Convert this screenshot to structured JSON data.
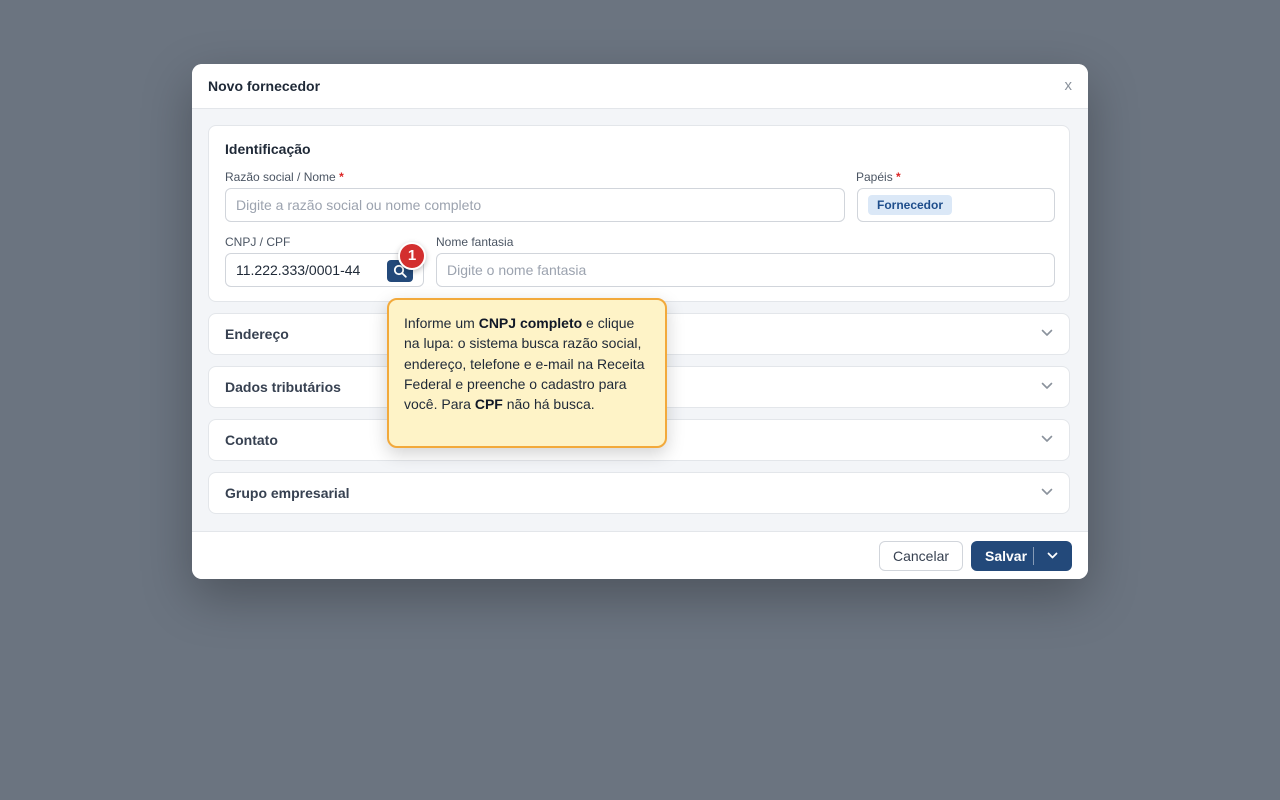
{
  "modal": {
    "title": "Novo fornecedor",
    "close_label": "x"
  },
  "identificacao": {
    "title": "Identificação",
    "razao_social": {
      "label": "Razão social / Nome",
      "required_mark": "*",
      "placeholder": "Digite a razão social ou nome completo",
      "value": ""
    },
    "papeis": {
      "label": "Papéis",
      "required_mark": "*",
      "chips": [
        "Fornecedor"
      ]
    },
    "cnpj_cpf": {
      "label": "CNPJ / CPF",
      "value": "11.222.333/0001-44",
      "search_icon": "search-icon"
    },
    "nome_fantasia": {
      "label": "Nome fantasia",
      "placeholder": "Digite o nome fantasia",
      "value": ""
    }
  },
  "sections": [
    {
      "title": "Endereço",
      "icon": "chevron-down-icon"
    },
    {
      "title": "Dados tributários",
      "icon": "chevron-down-icon"
    },
    {
      "title": "Contato",
      "icon": "chevron-down-icon"
    },
    {
      "title": "Grupo empresarial",
      "icon": "chevron-down-icon"
    }
  ],
  "step_badge": "1",
  "tooltip": {
    "t1": "Informe um ",
    "b1": "CNPJ completo",
    "t2": " e clique na lupa: o sistema busca razão social, endereço, telefone e e-mail na Receita Federal e preenche o cadastro para você. Para ",
    "b2": "CPF",
    "t3": " não há busca."
  },
  "footer": {
    "cancel_label": "Cancelar",
    "save_label": "Salvar",
    "save_menu_icon": "chevron-down-icon"
  },
  "colors": {
    "backdrop": "#6b7480",
    "primary": "#23497a",
    "badge": "#d32f2f",
    "tooltip_bg": "#fef3c7",
    "tooltip_border": "#f2a93b",
    "chip_bg": "#dbe8f7",
    "required": "#dc2626"
  }
}
